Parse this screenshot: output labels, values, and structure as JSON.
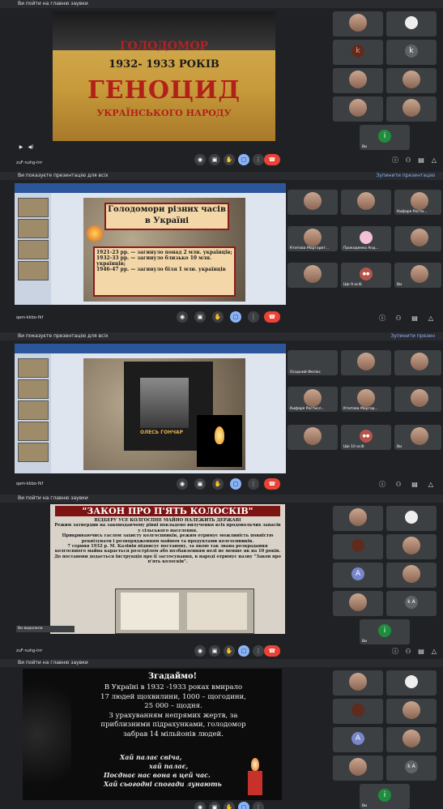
{
  "colors": {
    "meet_bg": "#202124",
    "tile_bg": "#3c4043",
    "end_call": "#ea4335",
    "accent": "#8ab4f8",
    "green_avatar": "#1e8e3e"
  },
  "panel1": {
    "topbar": {
      "left": "Ви пойти на главню заувки",
      "right": ""
    },
    "slide": {
      "line1": "ГОЛОДОМОР",
      "line2": "1932- 1933 РОКІВ",
      "line3": "ГЕНОЦИД",
      "line4": "УКРАЇНСЬКОГО НАРОДУ"
    },
    "tiles": [
      {
        "name": "",
        "av": ""
      },
      {
        "name": "",
        "av": ""
      },
      {
        "name": "",
        "av": "k"
      },
      {
        "name": "",
        "av": "k"
      },
      {
        "name": "",
        "av": ""
      },
      {
        "name": "",
        "av": ""
      },
      {
        "name": "",
        "av": ""
      },
      {
        "name": "",
        "av": ""
      },
      {
        "name": "Ви",
        "av": "i"
      }
    ],
    "meeting_code": "zuF-nuhg-irrr"
  },
  "panel2": {
    "topbar": {
      "left": "Ви показуєте презентацію для всіх",
      "right": "Зупинити презентацію"
    },
    "slide": {
      "title": "Голодомори різних часів в Україні",
      "rows": [
        "1921-23 рр. — загинуло понад 2 млн. українців;",
        "1932-33 рр. — загинуло близько 10 млн. українців;",
        "1946-47 рр. — загинуло біля 1 млн. українців"
      ]
    },
    "tiles": [
      {
        "name": "",
        "av": ""
      },
      {
        "name": "",
        "av": ""
      },
      {
        "name": "Кифаря Рости...",
        "av": ""
      },
      {
        "name": "Ктитова Маргарит...",
        "av": ""
      },
      {
        "name": "Прокоденко Анд...",
        "av": ""
      },
      {
        "name": "",
        "av": ""
      },
      {
        "name": "",
        "av": ""
      },
      {
        "name": "Ще 9 осіб",
        "av": ""
      },
      {
        "name": "Ви",
        "av": ""
      }
    ],
    "meeting_code": "qam-kkbo-fkf"
  },
  "panel3": {
    "topbar": {
      "left": "Ви показуєте презентацію для всіх",
      "right": "Зупинити презен"
    },
    "slide": {
      "caption": "ОЛЕСЬ ГОНЧАР"
    },
    "tiles": [
      {
        "name": "Осадний Фелікс",
        "av": ""
      },
      {
        "name": "",
        "av": ""
      },
      {
        "name": "",
        "av": ""
      },
      {
        "name": "Кифаря Ростисл...",
        "av": ""
      },
      {
        "name": "Ктитова Маргар...",
        "av": ""
      },
      {
        "name": "",
        "av": ""
      },
      {
        "name": "",
        "av": ""
      },
      {
        "name": "Ще 10 осіб",
        "av": ""
      },
      {
        "name": "Ви",
        "av": ""
      }
    ],
    "meeting_code": "qam-kkbo-fkf"
  },
  "panel4": {
    "topbar": {
      "left": "Ви пойти на главню заувки",
      "right": ""
    },
    "slide": {
      "title": "\"ЗАКОН ПРО П'ЯТЬ КОЛОСКІВ\"",
      "subtitle": "ВІДБЕРУ УСЕ КОЛГОСПНЕ МАЙНО НАЛЕЖИТЬ ДЕРЖАВІ",
      "p1": "Режим затвердив на законодавчому рівні покладено вилучення всіх продовольчих запасів у сільського населення.",
      "p2": "Прикриваючись гаслом захисту колгоспників, режим отримує можливість повністю реквізувати і розпорядженням майном та продуктами колгоспників.",
      "p3": "7 серпня 1932 р. М. Калінін підписує постанову, за якою так звана розкрадання колгоспного майна карається розстрілом або позбавленням волі не менше як на 10 років. До постанови додається інструкція про її застосування, в народі отримує назву \"Закон про п'ять колосків\"."
    },
    "tiles": [
      {
        "name": "",
        "av": ""
      },
      {
        "name": "",
        "av": ""
      },
      {
        "name": "",
        "av": ""
      },
      {
        "name": "",
        "av": ""
      },
      {
        "name": "",
        "av": "A"
      },
      {
        "name": "",
        "av": ""
      },
      {
        "name": "",
        "av": ""
      },
      {
        "name": "",
        "av": "k A"
      },
      {
        "name": "Ви",
        "av": "i"
      }
    ],
    "notice": "Ви видалили",
    "meeting_code": "zuF-nuhg-irrr"
  },
  "panel5": {
    "topbar": {
      "left": "Ви пойти на главню заувки",
      "right": ""
    },
    "slide": {
      "title": "Згадаймо!",
      "lines": [
        "В Україні в 1932 -1933 роках вмирало",
        "17 людей щохвилини, 1000 – щогодини,",
        "25 000 – щодня.",
        "З урахуванням непрямих жертв, за",
        "приблизними підрахунками, голодомор",
        "забрав 14 мільйонів людей."
      ],
      "poem": [
        "Хай палає свіча,",
        "хай палає,",
        "Посднає нас вона в цей час.",
        "Хай сьогодні спогади лунають"
      ]
    },
    "tiles": [
      {
        "name": "",
        "av": ""
      },
      {
        "name": "",
        "av": ""
      },
      {
        "name": "",
        "av": ""
      },
      {
        "name": "",
        "av": ""
      },
      {
        "name": "",
        "av": "A"
      },
      {
        "name": "",
        "av": ""
      },
      {
        "name": "",
        "av": ""
      },
      {
        "name": "",
        "av": "k A"
      },
      {
        "name": "Ви",
        "av": "i"
      }
    ]
  }
}
